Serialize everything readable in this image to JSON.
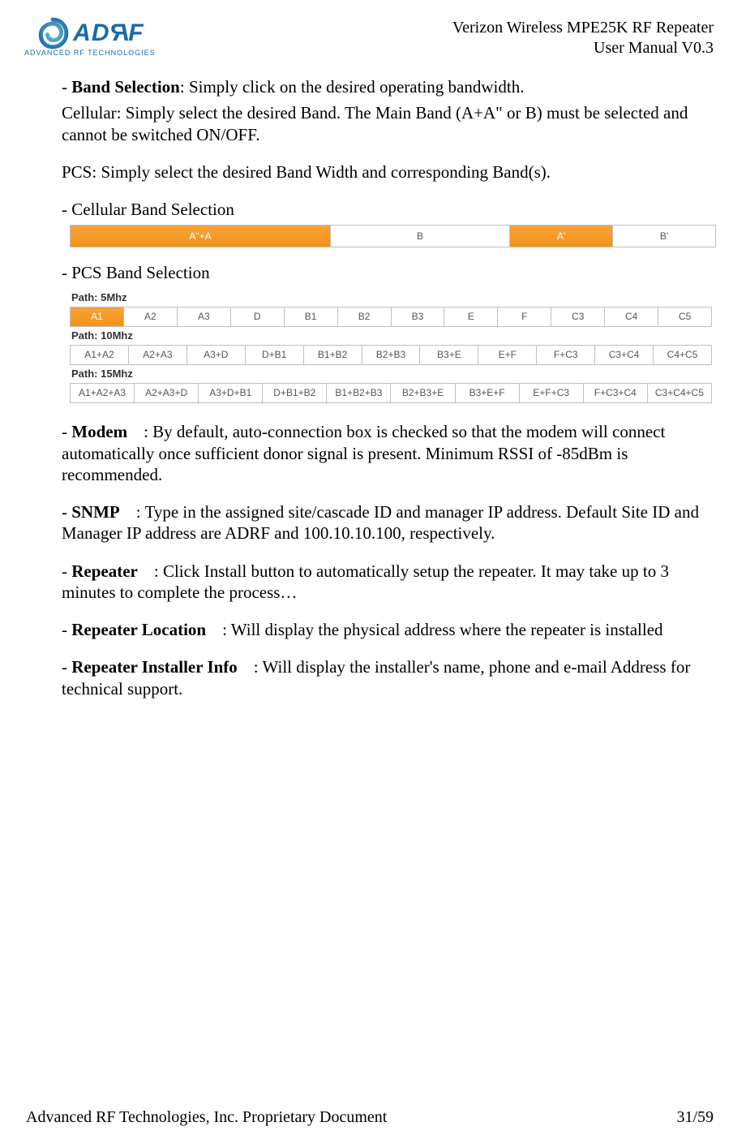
{
  "header": {
    "logo_main": "ADRF",
    "logo_sub": "ADVANCED RF TECHNOLOGIES",
    "title_line1": "Verizon Wireless MPE25K RF Repeater",
    "title_line2": "User Manual V0.3"
  },
  "body": {
    "band_selection_lead": "- ",
    "band_selection_bold": "Band Selection",
    "band_selection_rest": ": Simply click on the desired operating bandwidth.",
    "cellular_line": "Cellular: Simply select the desired Band. The Main Band (A+A\" or B) must be selected and cannot be switched ON/OFF.",
    "pcs_line": "PCS: Simply select the desired Band Width and corresponding Band(s).",
    "cell_heading": "-  Cellular Band Selection",
    "pcs_heading": "-  PCS Band Selection",
    "modem_lead": "- ",
    "modem_bold": "Modem",
    "modem_rest": ": By default, auto-connection box is checked so that the modem will connect automatically once sufficient donor signal is present.    Minimum RSSI of -85dBm is recommended.",
    "snmp_lead": "- ",
    "snmp_bold": "SNMP",
    "snmp_rest": ": Type in the assigned site/cascade ID and manager IP address. Default Site ID and Manager IP address are ADRF and 100.10.10.100, respectively.",
    "repeater_lead": "- ",
    "repeater_bold": "Repeater",
    "repeater_rest": ": Click Install button to automatically setup the repeater.    It may take up to 3 minutes to complete the process…",
    "loc_lead": "- ",
    "loc_bold": "Repeater Location",
    "loc_rest": ":    Will display the physical address where the repeater is installed",
    "inst_lead": "- ",
    "inst_bold": "Repeater Installer Info",
    "inst_rest": ": Will display the installer's name, phone and e-mail Address for technical support."
  },
  "cellular_bar": {
    "cells": [
      {
        "label": "A\"+A",
        "selected": true,
        "cls": "w-main"
      },
      {
        "label": "B",
        "selected": false,
        "cls": "w-b"
      },
      {
        "label": "A'",
        "selected": true,
        "cls": "w-ap"
      },
      {
        "label": "B'",
        "selected": false,
        "cls": "w-bp"
      }
    ]
  },
  "pcs": {
    "groups": [
      {
        "label": "Path: 5Mhz",
        "cells": [
          "A1",
          "A2",
          "A3",
          "D",
          "B1",
          "B2",
          "B3",
          "E",
          "F",
          "C3",
          "C4",
          "C5"
        ],
        "selected_index": 0
      },
      {
        "label": "Path: 10Mhz",
        "cells": [
          "A1+A2",
          "A2+A3",
          "A3+D",
          "D+B1",
          "B1+B2",
          "B2+B3",
          "B3+E",
          "E+F",
          "F+C3",
          "C3+C4",
          "C4+C5"
        ],
        "selected_index": -1
      },
      {
        "label": "Path: 15Mhz",
        "cells": [
          "A1+A2+A3",
          "A2+A3+D",
          "A3+D+B1",
          "D+B1+B2",
          "B1+B2+B3",
          "B2+B3+E",
          "B3+E+F",
          "E+F+C3",
          "F+C3+C4",
          "C3+C4+C5"
        ],
        "selected_index": -1
      }
    ]
  },
  "footer": {
    "left": "Advanced RF Technologies, Inc. Proprietary Document",
    "right": "31/59"
  }
}
